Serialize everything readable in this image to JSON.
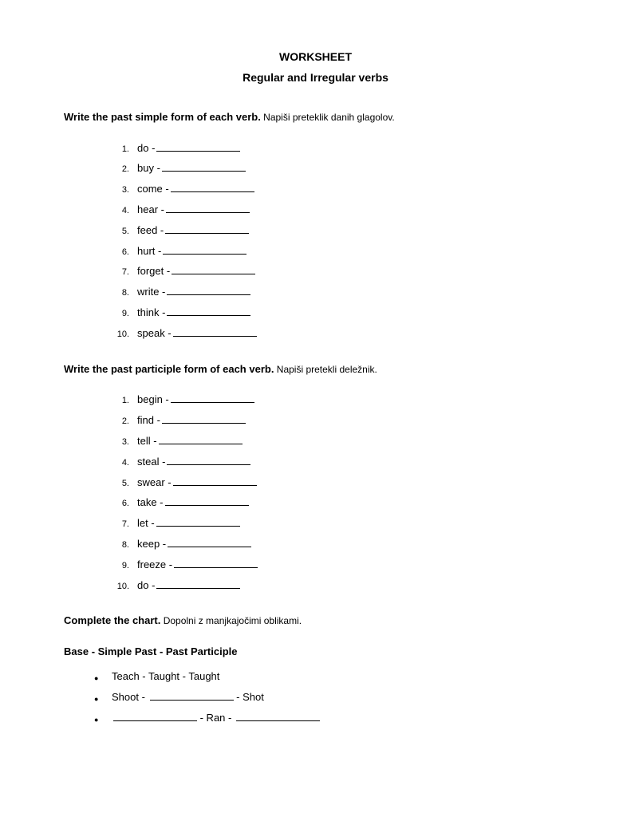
{
  "title": "WORKSHEET",
  "subtitle": "Regular and Irregular verbs",
  "section1": {
    "instruction_bold": "Write the past simple form of each verb.",
    "instruction_sub": " Napiši preteklik danih glagolov.",
    "items": [
      {
        "n": "1.",
        "v": "do - "
      },
      {
        "n": "2.",
        "v": "buy - "
      },
      {
        "n": "3.",
        "v": "come - "
      },
      {
        "n": "4.",
        "v": "hear - "
      },
      {
        "n": "5.",
        "v": "feed - "
      },
      {
        "n": "6.",
        "v": "hurt - "
      },
      {
        "n": "7.",
        "v": "forget - "
      },
      {
        "n": "8.",
        "v": "write - "
      },
      {
        "n": "9.",
        "v": "think - "
      },
      {
        "n": "10.",
        "v": "speak - "
      }
    ]
  },
  "section2": {
    "instruction_bold": "Write the past participle form of each verb.",
    "instruction_sub": " Napiši pretekli deležnik.",
    "items": [
      {
        "n": "1.",
        "v": "begin - "
      },
      {
        "n": "2.",
        "v": "find - "
      },
      {
        "n": "3.",
        "v": "tell - "
      },
      {
        "n": "4.",
        "v": "steal - "
      },
      {
        "n": "5.",
        "v": "swear - "
      },
      {
        "n": "6.",
        "v": "take - "
      },
      {
        "n": "7.",
        "v": "let - "
      },
      {
        "n": "8.",
        "v": "keep - "
      },
      {
        "n": "9.",
        "v": "freeze - "
      },
      {
        "n": "10.",
        "v": "do - "
      }
    ]
  },
  "section3": {
    "instruction_bold": "Complete the chart.",
    "instruction_sub": " Dopolni z manjkajočimi oblikami.",
    "heading": "Base - Simple Past - Past Participle",
    "rows": [
      {
        "parts": [
          {
            "t": "Teach - Taught - Taught",
            "blank": false
          }
        ]
      },
      {
        "parts": [
          {
            "t": "Shoot - ",
            "blank": false
          },
          {
            "t": "",
            "blank": true
          },
          {
            "t": " - Shot",
            "blank": false
          }
        ]
      },
      {
        "parts": [
          {
            "t": "",
            "blank": true
          },
          {
            "t": " - Ran - ",
            "blank": false
          },
          {
            "t": "",
            "blank": true
          }
        ]
      }
    ]
  }
}
